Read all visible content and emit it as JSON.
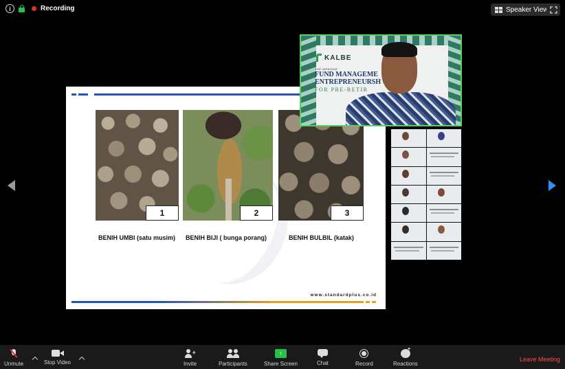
{
  "topbar": {
    "recording_label": "Recording",
    "speaker_view_label": "Speaker View"
  },
  "slide": {
    "photos": [
      {
        "number": "1",
        "caption": "BENIH UMBI (satu musim)"
      },
      {
        "number": "2",
        "caption": "BENIH BIJI ( bunga porang)"
      },
      {
        "number": "3",
        "caption": "BENIH BULBIL (katak)"
      }
    ],
    "url": "www.standardplus.co.id"
  },
  "speaker_tile": {
    "brand": "KALBE",
    "line1": "THE WEBINAR",
    "line2": "FUND MANAGEME",
    "line3": "ENTREPRENEURSH        OP",
    "line4": "FOR PRE-RETIR"
  },
  "toolbar": {
    "unmute": "Unmute",
    "stop_video": "Stop Video",
    "invite": "Invite",
    "participants": "Participants",
    "share_screen": "Share Screen",
    "chat": "Chat",
    "record": "Record",
    "reactions": "Reactions",
    "leave_meeting": "Leave Meeting"
  },
  "colors": {
    "leave": "#ff4c4c",
    "share": "#27c24c",
    "recording_dot": "#e0302d",
    "next_arrow": "#2e8fff"
  }
}
